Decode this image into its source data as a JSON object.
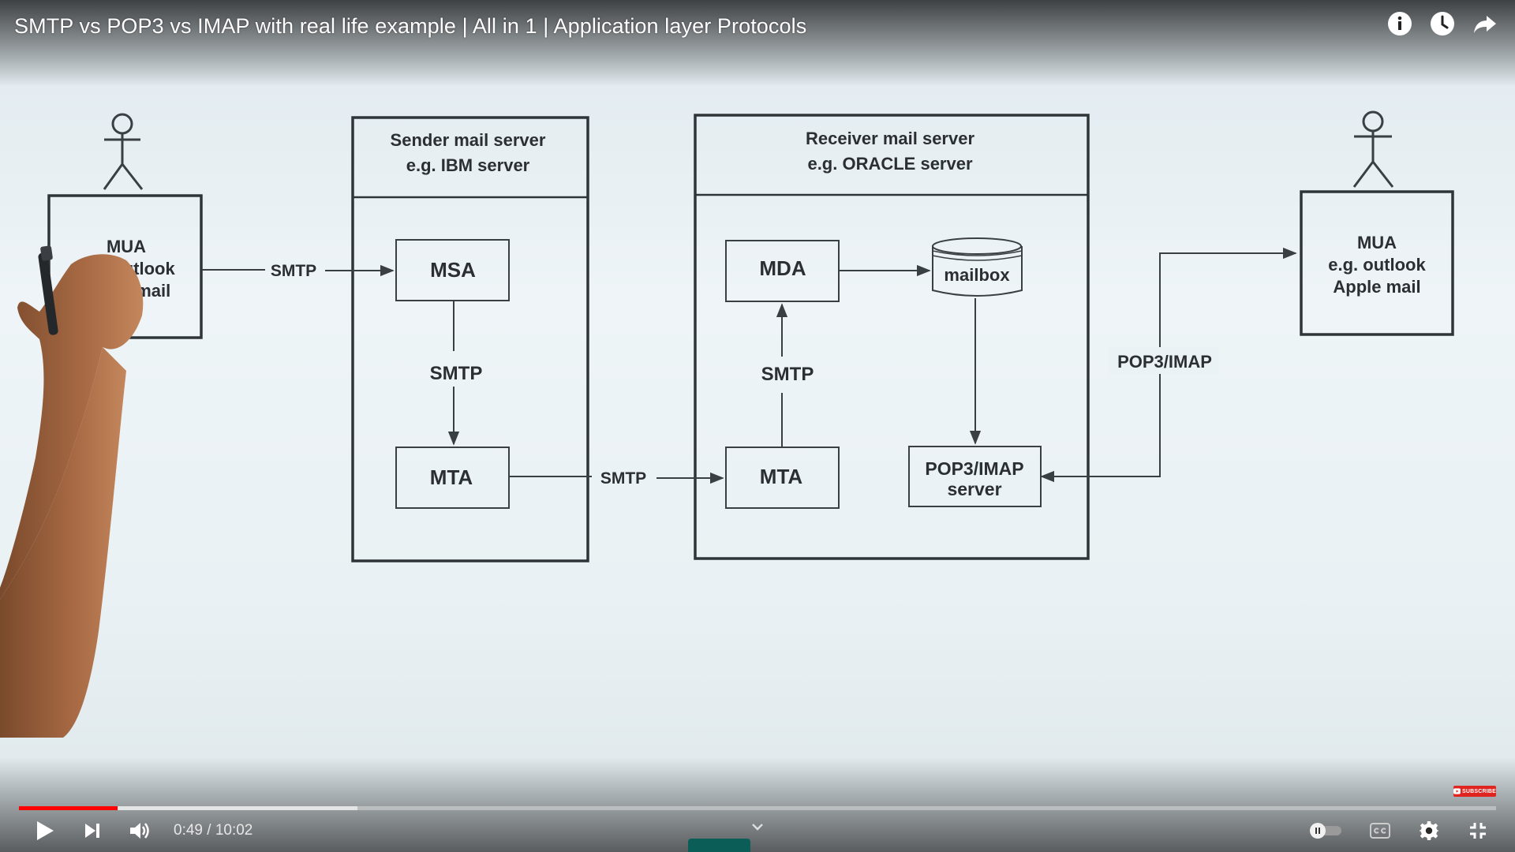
{
  "video": {
    "title": "SMTP vs POP3 vs IMAP with real life example | All in 1 | Application layer Protocols",
    "time_current": "0:49",
    "time_separator": " / ",
    "time_total": "10:02",
    "progress_played": 0.067,
    "progress_buffered": 0.229,
    "subscribe_label": "SUBSCRIBE"
  },
  "icons": {
    "info": "info-icon",
    "watch_later": "clock-icon",
    "share": "share-icon",
    "play": "play-icon",
    "next": "next-icon",
    "volume": "volume-icon",
    "autoplay": "autoplay-toggle-icon",
    "captions": "captions-icon",
    "settings": "gear-icon",
    "exit_fullscreen": "exit-fullscreen-icon",
    "expand": "chevron-down-icon"
  },
  "colors": {
    "progress_played": "#ff0000",
    "accent_tab": "#0b5e57"
  },
  "diagram": {
    "sender_mua": {
      "line1": "MUA",
      "line2": "e.g. outlook",
      "line3": "le mail"
    },
    "receiver_mua": {
      "line1": "MUA",
      "line2": "e.g. outlook",
      "line3": "Apple mail"
    },
    "sender_server": {
      "title_line1": "Sender mail server",
      "title_line2": "e.g. IBM server",
      "msa": "MSA",
      "mta": "MTA",
      "internal_protocol": "SMTP"
    },
    "receiver_server": {
      "title_line1": "Receiver mail server",
      "title_line2": "e.g. ORACLE server",
      "mda": "MDA",
      "mailbox": "mailbox",
      "mta": "MTA",
      "pop_server_line1": "POP3/IMAP",
      "pop_server_line2": "server",
      "internal_protocol": "SMTP"
    },
    "links": {
      "mua_to_msa": "SMTP",
      "mta_to_mta": "SMTP",
      "pop_to_mua": "POP3/IMAP"
    }
  }
}
